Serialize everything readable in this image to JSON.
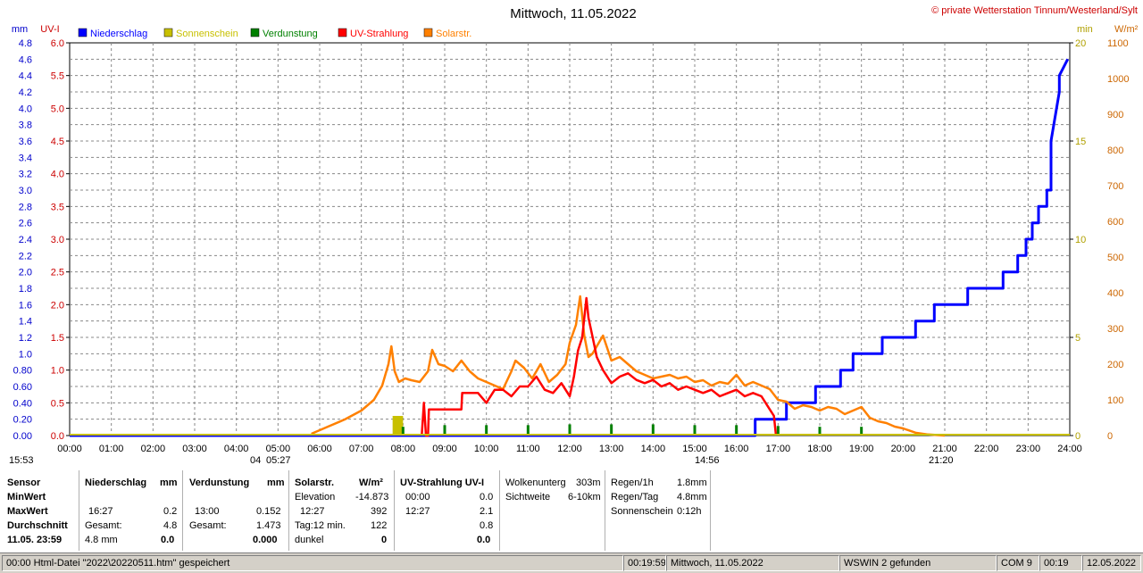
{
  "chart_data": {
    "type": "line",
    "title": "Mittwoch, 11.05.2022",
    "credit": "© private Wetterstation Tinnum/Westerland/Sylt",
    "left_axes": {
      "mm": {
        "label": "mm",
        "range": [
          0,
          4.8
        ],
        "ticks": [
          "0.00",
          "0.20",
          "0.40",
          "0.60",
          "0.80",
          "1.0",
          "1.2",
          "1.4",
          "1.6",
          "1.8",
          "2.0",
          "2.2",
          "2.4",
          "2.6",
          "2.8",
          "3.0",
          "3.2",
          "3.4",
          "3.6",
          "3.8",
          "4.0",
          "4.2",
          "4.4",
          "4.6",
          "4.8"
        ],
        "color": "#0000cc"
      },
      "uv": {
        "label": "UV-I",
        "range": [
          0,
          6
        ],
        "ticks": [
          "0.0",
          "0.5",
          "1.0",
          "1.5",
          "2.0",
          "2.5",
          "3.0",
          "3.5",
          "4.0",
          "4.5",
          "5.0",
          "5.5",
          "6.0"
        ],
        "color": "#cc0000"
      }
    },
    "right_axes": {
      "min": {
        "label": "min",
        "range": [
          0,
          20
        ],
        "ticks": [
          "0",
          "5",
          "10",
          "15",
          "20"
        ],
        "color": "#b0a000"
      },
      "wm2": {
        "label": "W/m²",
        "range": [
          0,
          1100
        ],
        "ticks": [
          "0",
          "100",
          "200",
          "300",
          "400",
          "500",
          "600",
          "700",
          "800",
          "900",
          "1000",
          "1100"
        ],
        "color": "#cc6600"
      }
    },
    "x_ticks": [
      "00:00",
      "01:00",
      "02:00",
      "03:00",
      "04:00",
      "05:00",
      "06:00",
      "07:00",
      "08:00",
      "09:00",
      "10:00",
      "11:00",
      "12:00",
      "13:00",
      "14:00",
      "15:00",
      "16:00",
      "17:00",
      "18:00",
      "19:00",
      "20:00",
      "21:00",
      "22:00",
      "23:00",
      "24:00"
    ],
    "x_range_hours": [
      0,
      24
    ],
    "legend": [
      {
        "name": "Niederschlag",
        "color": "#0000ff"
      },
      {
        "name": "Sonnenschein",
        "color": "#c8c000"
      },
      {
        "name": "Verdunstung",
        "color": "#008000"
      },
      {
        "name": "UV-Strahlung",
        "color": "#ff0000"
      },
      {
        "name": "Solarstr.",
        "color": "#ff8000"
      }
    ],
    "astro_labels": {
      "moonrise": "15:53",
      "sunrise": "04",
      "sunrise2": "05:27",
      "moonset": "14:56",
      "sunset": "21:20"
    },
    "series": [
      {
        "name": "Niederschlag",
        "axis": "mm",
        "style": "step",
        "x": [
          0,
          16.45,
          16.45,
          17.2,
          17.2,
          17.9,
          17.9,
          18.5,
          18.5,
          18.8,
          18.8,
          19.5,
          19.5,
          20.3,
          20.3,
          20.75,
          20.75,
          21.55,
          21.55,
          22.4,
          22.4,
          22.75,
          22.75,
          22.95,
          22.95,
          23.1,
          23.1,
          23.25,
          23.25,
          23.45,
          23.45,
          23.55,
          23.55,
          23.75,
          23.75,
          23.95
        ],
        "y": [
          0,
          0,
          0.2,
          0.2,
          0.4,
          0.4,
          0.6,
          0.6,
          0.8,
          0.8,
          1.0,
          1.0,
          1.2,
          1.2,
          1.4,
          1.4,
          1.6,
          1.6,
          1.8,
          1.8,
          2.0,
          2.0,
          2.2,
          2.2,
          2.4,
          2.4,
          2.6,
          2.6,
          2.8,
          2.8,
          3.0,
          3.0,
          3.6,
          4.2,
          4.4,
          4.6
        ]
      },
      {
        "name": "Solarstr.",
        "axis": "wm2",
        "style": "line",
        "x": [
          5.8,
          6.2,
          6.6,
          7.0,
          7.3,
          7.5,
          7.65,
          7.72,
          7.8,
          7.9,
          8.05,
          8.2,
          8.4,
          8.6,
          8.7,
          8.85,
          9.0,
          9.2,
          9.4,
          9.6,
          9.8,
          10.0,
          10.2,
          10.4,
          10.6,
          10.7,
          10.9,
          11.1,
          11.3,
          11.5,
          11.7,
          11.9,
          12.0,
          12.15,
          12.25,
          12.35,
          12.45,
          12.55,
          12.65,
          12.8,
          13.0,
          13.2,
          13.4,
          13.6,
          13.8,
          14.0,
          14.2,
          14.4,
          14.6,
          14.8,
          15.0,
          15.2,
          15.4,
          15.6,
          15.8,
          16.0,
          16.2,
          16.4,
          16.6,
          16.8,
          17.0,
          17.2,
          17.4,
          17.6,
          17.8,
          18.0,
          18.2,
          18.4,
          18.6,
          18.8,
          19.0,
          19.2,
          19.4,
          19.6,
          19.8,
          20.0,
          20.3,
          20.6,
          21.0
        ],
        "y": [
          5,
          25,
          45,
          70,
          100,
          140,
          200,
          250,
          180,
          150,
          160,
          155,
          150,
          180,
          240,
          200,
          195,
          180,
          210,
          180,
          160,
          150,
          140,
          130,
          180,
          210,
          190,
          160,
          200,
          150,
          170,
          200,
          260,
          310,
          390,
          280,
          220,
          230,
          250,
          280,
          210,
          220,
          200,
          180,
          170,
          160,
          165,
          170,
          160,
          165,
          150,
          155,
          140,
          150,
          145,
          170,
          140,
          150,
          140,
          130,
          100,
          95,
          75,
          85,
          80,
          70,
          80,
          75,
          60,
          70,
          80,
          50,
          40,
          35,
          25,
          20,
          8,
          3,
          0
        ]
      },
      {
        "name": "UV-Strahlung",
        "axis": "uv",
        "style": "line",
        "x": [
          8.45,
          8.5,
          8.55,
          8.6,
          8.62,
          9.4,
          9.42,
          9.8,
          10.0,
          10.2,
          10.4,
          10.6,
          10.8,
          11.0,
          11.2,
          11.4,
          11.6,
          11.8,
          12.0,
          12.1,
          12.2,
          12.3,
          12.4,
          12.45,
          12.55,
          12.65,
          12.8,
          13.0,
          13.2,
          13.4,
          13.6,
          13.8,
          14.0,
          14.2,
          14.4,
          14.6,
          14.8,
          15.0,
          15.2,
          15.4,
          15.6,
          15.8,
          16.0,
          16.2,
          16.4,
          16.6,
          16.8,
          16.9,
          16.95
        ],
        "y": [
          0,
          0.5,
          0.0,
          0.0,
          0.4,
          0.4,
          0.65,
          0.65,
          0.5,
          0.7,
          0.7,
          0.6,
          0.75,
          0.75,
          0.9,
          0.7,
          0.65,
          0.8,
          0.6,
          0.9,
          1.3,
          1.5,
          2.1,
          1.8,
          1.5,
          1.2,
          1.0,
          0.8,
          0.9,
          0.95,
          0.85,
          0.8,
          0.85,
          0.75,
          0.8,
          0.7,
          0.75,
          0.7,
          0.65,
          0.7,
          0.6,
          0.65,
          0.7,
          0.6,
          0.65,
          0.6,
          0.4,
          0.3,
          0
        ]
      },
      {
        "name": "Sonnenschein",
        "axis": "min",
        "style": "bar",
        "x": [
          7.75
        ],
        "width": 0.25,
        "y": [
          1.0
        ]
      },
      {
        "name": "Verdunstung",
        "axis": "mm",
        "style": "spikes",
        "x": [
          8.0,
          9.0,
          10.0,
          11.0,
          12.0,
          13.0,
          14.0,
          15.0,
          16.0,
          17.0,
          18.0,
          19.0
        ],
        "y": [
          0.02,
          0.04,
          0.04,
          0.04,
          0.05,
          0.05,
          0.05,
          0.04,
          0.04,
          0.03,
          0.02,
          0.02
        ]
      }
    ]
  },
  "table": {
    "sensor": {
      "h0": "Sensor",
      "r1": "MinWert",
      "r2": "MaxWert",
      "r3": "Durchschnitt",
      "r4": "11.05. 23:59"
    },
    "niederschlag": {
      "h": "Niederschlag",
      "unit": "mm",
      "max_t": "16:27",
      "max_v": "0.2",
      "ges_l": "Gesamt:",
      "ges_v": "4.8",
      "avg_l": "4.8 mm",
      "avg_v": "0.0"
    },
    "verdunstung": {
      "h": "Verdunstung",
      "unit": "mm",
      "max_t": "13:00",
      "max_v": "0.152",
      "ges_l": "Gesamt:",
      "ges_v": "1.473",
      "avg_v": "0.000"
    },
    "solar": {
      "h": "Solarstr.",
      "unit": "W/m²",
      "elev_l": "Elevation",
      "elev_v": "-14.873",
      "max_t": "12:27",
      "max_v": "392",
      "tag_l": "Tag:12 min.",
      "tag_v": "122",
      "dunkel_l": "dunkel",
      "dunkel_v": "0"
    },
    "uv": {
      "h": "UV-Strahlung UV-I",
      "min_t": "00:00",
      "min_v": "0.0",
      "max_t": "12:27",
      "max_v": "2.1",
      "avg_v": "0.8",
      "last_v": "0.0"
    },
    "wolken": {
      "l1": "Wolkenunterg",
      "v1": "303m",
      "l2": "Sichtweite",
      "v2": "6-10km"
    },
    "regen": {
      "l1": "Regen/1h",
      "v1": "1.8mm",
      "l2": "Regen/Tag",
      "v2": "4.8mm",
      "l3": "Sonnenschein",
      "v3": "0:12h"
    }
  },
  "status": {
    "s1": "00:00  Html-Datei  \"2022\\20220511.htm\"  gespeichert",
    "s2": "00:19:59",
    "s3": "Mittwoch, 11.05.2022",
    "s4": "WSWIN 2 gefunden",
    "s5": "COM 9",
    "s6": "00:19",
    "s7": "12.05.2022"
  }
}
